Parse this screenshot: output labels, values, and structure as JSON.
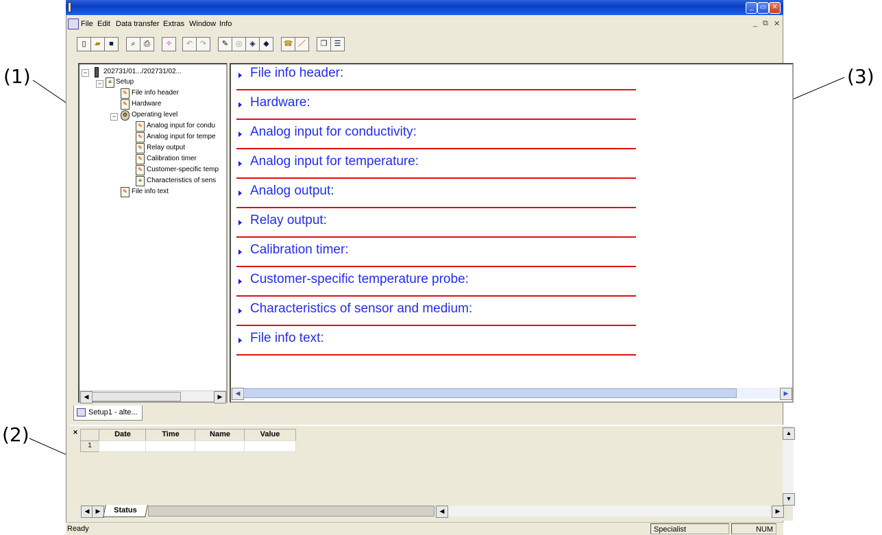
{
  "callouts": [
    "(1)",
    "(2)",
    "(3)"
  ],
  "window": {
    "min": "_",
    "restore": "▭",
    "close": "✕",
    "child_min": "_",
    "child_restore": "⧉",
    "child_close": "✕"
  },
  "menu": {
    "items": [
      "File",
      "Edit",
      "Data transfer",
      "Extras",
      "Window",
      "Info"
    ]
  },
  "toolbar": {
    "buttons": [
      "new-icon",
      "open-icon",
      "save-icon",
      "print-preview-icon",
      "print-icon",
      "wizard-icon",
      "undo-icon",
      "redo-icon",
      "transfer-icon",
      "compare-icon",
      "receive-icon",
      "send-icon",
      "connect-icon",
      "edit-icon",
      "cascade-icon",
      "tile-icon"
    ]
  },
  "tree": {
    "root": "202731/01.../202731/02...",
    "items": [
      "Setup",
      "File info header",
      "Hardware",
      "Operating level",
      "Analog input for condu",
      "Analog input for tempe",
      "Relay output",
      "Calibration timer",
      "Customer-specific temp",
      "Characteristics of sens",
      "File info text"
    ]
  },
  "sections": [
    "File info header:",
    "Hardware:",
    "Analog input for conductivity:",
    "Analog input for temperature:",
    "Analog output:",
    "Relay output:",
    "Calibration timer:",
    "Customer-specific temperature probe:",
    "Characteristics of sensor and medium:",
    "File info text:"
  ],
  "doc_tab": {
    "label": "Setup1 - alte..."
  },
  "grid": {
    "headers": [
      "Date",
      "Time",
      "Name",
      "Value"
    ],
    "row_num": "1"
  },
  "bottom_tab": {
    "label": "Status"
  },
  "statusbar": {
    "left": "Ready",
    "mode": "Specialist",
    "num": "NUM"
  },
  "colors": {
    "titlebar": "#0a3fc4",
    "section_text": "#1f2ef0",
    "divider": "#e01010",
    "chrome": "#ece9d8"
  }
}
